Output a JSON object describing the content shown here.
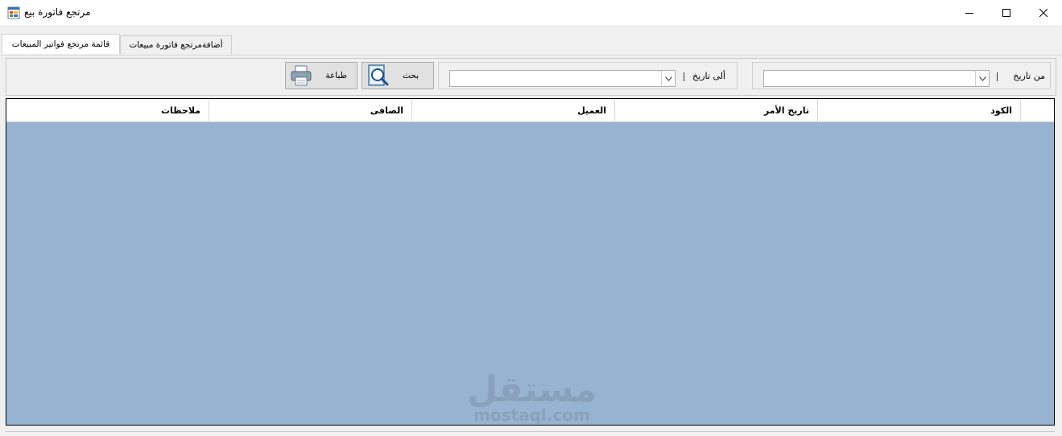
{
  "window": {
    "title": "مرتجع فاتورة بيع",
    "icon": "app-form-icon",
    "controls": {
      "minimize": "minimize-icon",
      "maximize": "maximize-icon",
      "close": "close-icon"
    }
  },
  "tabs": [
    {
      "label": "قائمة مرتجع فواتير المبيعات",
      "active": true
    },
    {
      "label": "أضافةمرتجع فاتورة مبيعات",
      "active": false
    }
  ],
  "filters": {
    "from_label": "من تاريخ",
    "from_value": "",
    "to_label": "ألى تاريخ",
    "to_value": ""
  },
  "buttons": {
    "search_label": "بحث",
    "search_icon": "magnifier-document-icon",
    "print_label": "طباعة",
    "print_icon": "printer-icon"
  },
  "table": {
    "columns": [
      "الكود",
      "تاريخ الأمر",
      "العميل",
      "الصافى",
      "ملاحظات"
    ],
    "rows": []
  },
  "watermark": {
    "arabic": "مستقل",
    "latin": "mostaql.com"
  },
  "colors": {
    "grid_background": "#98b3d1",
    "window_background": "#f0f0f0"
  }
}
